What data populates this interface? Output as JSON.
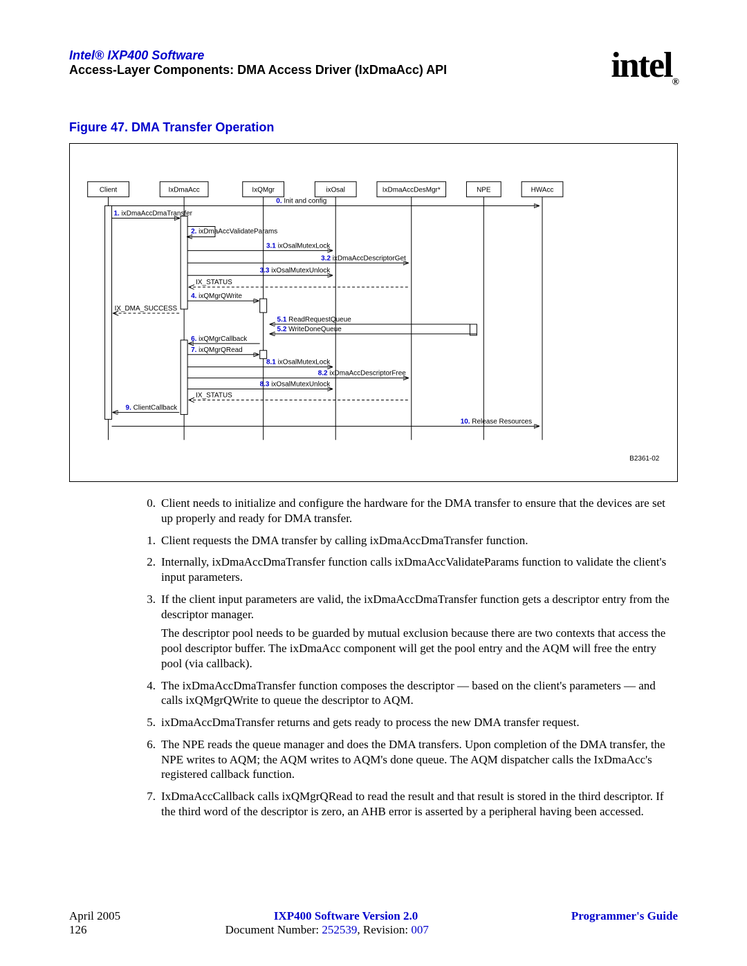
{
  "header": {
    "product_line": "Intel® IXP400 Software",
    "sub": "Access-Layer Components: DMA Access Driver (IxDmaAcc) API",
    "logo_text": "intel",
    "logo_reg": "®"
  },
  "figure": {
    "title": "Figure 47. DMA Transfer Operation",
    "ref": "B2361-02",
    "actors": [
      "Client",
      "IxDmaAcc",
      "IxQMgr",
      "ixOsal",
      "IxDmaAccDesMgr*",
      "NPE",
      "HWAcc"
    ],
    "msgs": {
      "m0": "Init and config",
      "m1": "ixDmaAccDmaTransfer",
      "m2": "ixDmaAccValidateParams",
      "m3_1": "ixOsalMutexLock",
      "m3_2": "ixDmaAccDescriptorGet",
      "m3_3": "ixOsalMutexUnlock",
      "r3_3": "IX_STATUS",
      "m4": "ixQMgrQWrite",
      "r4": "IX_DMA_SUCCESS",
      "m5_1": "ReadRequestQueue",
      "m5_2": "WriteDoneQueue",
      "m6": "ixQMgrCallback",
      "m7": "ixQMgrQRead",
      "m8_1": "ixOsalMutexLock",
      "m8_2": "ixDmaAccDescriptorFree",
      "m8_3": "ixOsalMutexUnlock",
      "r8_3": "IX_STATUS",
      "m9": "ClientCallback",
      "m10": "Release Resources"
    },
    "nums": {
      "n0": "0.",
      "n1": "1.",
      "n2": "2.",
      "n3_1": "3.1",
      "n3_2": "3.2",
      "n3_3": "3.3",
      "n4": "4.",
      "n5_1": "5.1",
      "n5_2": "5.2",
      "n6": "6.",
      "n7": "7.",
      "n8_1": "8.1",
      "n8_2": "8.2",
      "n8_3": "8.3",
      "n9": "9.",
      "n10": "10."
    }
  },
  "steps": [
    {
      "n": "0.",
      "t": "Client needs to initialize and configure the hardware for the DMA transfer to ensure that the devices are set up properly and ready for DMA transfer."
    },
    {
      "n": "1.",
      "t": "Client requests the DMA transfer by calling ixDmaAccDmaTransfer function."
    },
    {
      "n": "2.",
      "t": "Internally, ixDmaAccDmaTransfer function calls ixDmaAccValidateParams function to validate the client's input parameters."
    },
    {
      "n": "3.",
      "t": "If the client input parameters are valid, the ixDmaAccDmaTransfer function gets a descriptor entry from the descriptor manager.",
      "sub": "The descriptor pool needs to be guarded by mutual exclusion because there are two contexts that access the pool descriptor buffer. The ixDmaAcc component will get the pool entry and the AQM will free the entry pool (via callback)."
    },
    {
      "n": "4.",
      "t": "The ixDmaAccDmaTransfer function composes the descriptor — based on the client's parameters — and calls ixQMgrQWrite to queue the descriptor to AQM."
    },
    {
      "n": "5.",
      "t": "ixDmaAccDmaTransfer returns and gets ready to process the new DMA transfer request."
    },
    {
      "n": "6.",
      "t": "The NPE reads the queue manager and does the DMA transfers. Upon completion of the DMA transfer, the NPE writes to AQM; the AQM writes to AQM's done queue. The AQM dispatcher calls the IxDmaAcc's registered callback function."
    },
    {
      "n": "7.",
      "t": "IxDmaAccCallback calls ixQMgrQRead to read the result and that result is stored in the third descriptor. If the third word of the descriptor is zero, an AHB error is asserted by a peripheral having been accessed."
    }
  ],
  "footer": {
    "date": "April 2005",
    "page": "126",
    "version": "IXP400 Software Version 2.0",
    "docnum_label": "Document Number: ",
    "docnum": "252539",
    "rev_label": ", Revision: ",
    "rev": "007",
    "guide": "Programmer's Guide"
  }
}
